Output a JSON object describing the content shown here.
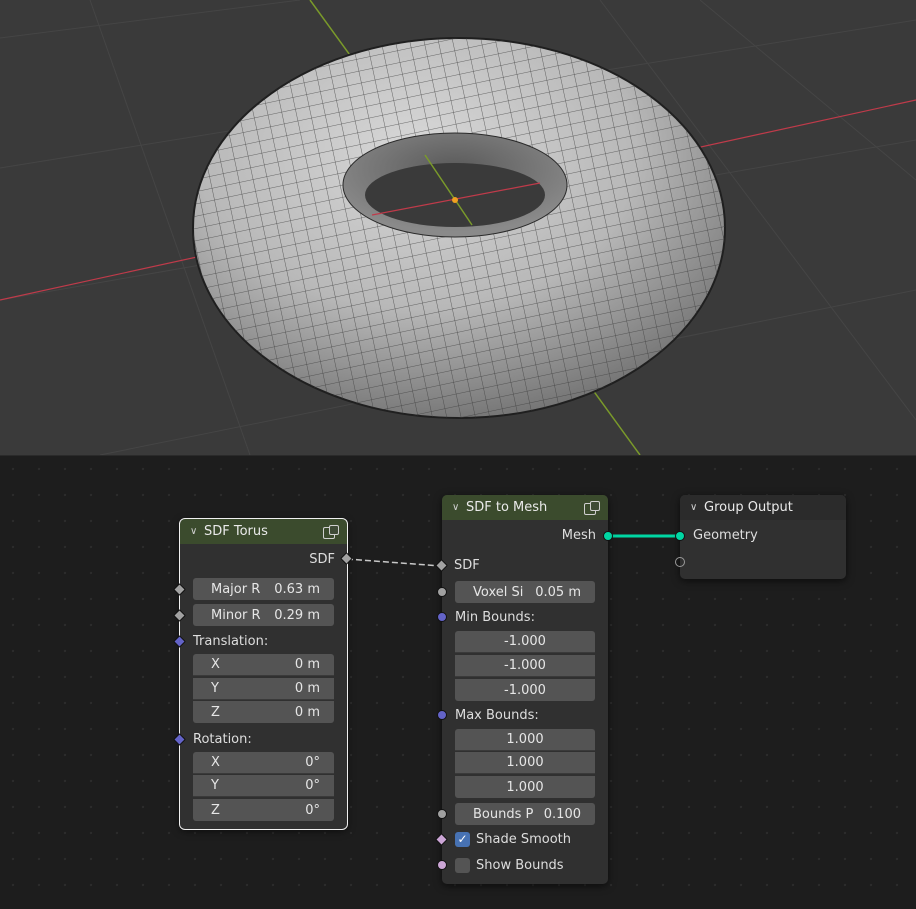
{
  "nodes": {
    "sdf_torus": {
      "title": "SDF Torus",
      "output_sdf": "SDF",
      "major_r": {
        "label": "Major R",
        "value": "0.63 m"
      },
      "minor_r": {
        "label": "Minor R",
        "value": "0.29 m"
      },
      "translation": {
        "label": "Translation:",
        "x": {
          "label": "X",
          "value": "0 m"
        },
        "y": {
          "label": "Y",
          "value": "0 m"
        },
        "z": {
          "label": "Z",
          "value": "0 m"
        }
      },
      "rotation": {
        "label": "Rotation:",
        "x": {
          "label": "X",
          "value": "0°"
        },
        "y": {
          "label": "Y",
          "value": "0°"
        },
        "z": {
          "label": "Z",
          "value": "0°"
        }
      }
    },
    "sdf_to_mesh": {
      "title": "SDF to Mesh",
      "output_mesh": "Mesh",
      "input_sdf": "SDF",
      "voxel_size": {
        "label": "Voxel Si",
        "value": "0.05 m"
      },
      "min_bounds": {
        "label": "Min Bounds:",
        "values": [
          "-1.000",
          "-1.000",
          "-1.000"
        ]
      },
      "max_bounds": {
        "label": "Max Bounds:",
        "values": [
          "1.000",
          "1.000",
          "1.000"
        ]
      },
      "bounds_padding": {
        "label": "Bounds P",
        "value": "0.100"
      },
      "shade_smooth": {
        "label": "Shade Smooth",
        "checked": true,
        "mark": "✓"
      },
      "show_bounds": {
        "label": "Show Bounds",
        "checked": false
      }
    },
    "group_output": {
      "title": "Group Output",
      "input_geometry": "Geometry"
    }
  },
  "colors": {
    "viewport_bg": "#3a3a3a",
    "editor_bg": "#1d1d1d",
    "node_body": "#303030",
    "header_green": "#3b4b2d",
    "geometry_socket": "#00d6a3",
    "vector_socket": "#6363c7",
    "x_axis": "#c03a4a",
    "y_axis": "#7a9a2a"
  },
  "icons": [
    "chevron-down-icon",
    "node-group-icon",
    "checkbox-checked-icon"
  ]
}
